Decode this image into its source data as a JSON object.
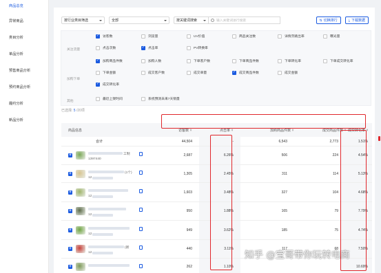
{
  "sidebar": {
    "items": [
      {
        "label": "商品总览",
        "active": true
      },
      {
        "label": "异常商品",
        "active": false
      },
      {
        "label": "类目分析",
        "active": false
      },
      {
        "label": "单品分析",
        "active": false
      },
      {
        "label": "预售商品分析",
        "active": false
      },
      {
        "label": "预约商品分析",
        "active": false
      },
      {
        "label": "履约分析",
        "active": false
      },
      {
        "label": "新品分析",
        "active": false
      }
    ]
  },
  "filters": {
    "category_select": "按行业类目筛选",
    "all_select": "全部",
    "search_mode": "按关键词搜索",
    "search_placeholder": "输入关键词进行搜索",
    "sort_button": "切换排行",
    "download_button": "下载数据"
  },
  "metrics": {
    "groups": [
      {
        "label": "关注流量",
        "rows": [
          [
            {
              "label": "访客数",
              "checked": true
            },
            {
              "label": "浏览量",
              "checked": false
            },
            {
              "label": "UV价值",
              "checked": false
            },
            {
              "label": "商品关注数",
              "checked": false
            },
            {
              "label": "详情页跳出率",
              "checked": false
            },
            {
              "label": "曝光量",
              "checked": false
            }
          ],
          [
            {
              "label": "点击次数",
              "checked": false
            },
            {
              "label": "点击率",
              "checked": true
            },
            {
              "label": "PV转换率",
              "checked": false
            }
          ]
        ]
      },
      {
        "label": "加购下单",
        "rows": [
          [
            {
              "label": "加购商品件数",
              "checked": true
            },
            {
              "label": "加购人数",
              "checked": false
            },
            {
              "label": "下单客户数",
              "checked": false
            },
            {
              "label": "下单商品件数",
              "checked": false
            },
            {
              "label": "下单转化率",
              "checked": false
            },
            {
              "label": "下单成交转化率",
              "checked": false
            }
          ],
          [
            {
              "label": "下单金额",
              "checked": false
            },
            {
              "label": "成交客户数",
              "checked": false
            },
            {
              "label": "成交单量",
              "checked": false
            },
            {
              "label": "成交商品件数",
              "checked": true
            },
            {
              "label": "成交金额",
              "checked": false
            }
          ],
          [
            {
              "label": "成交转化率",
              "checked": true
            }
          ]
        ]
      },
      {
        "label": "其他",
        "rows": [
          [
            {
              "label": "最近上架时间",
              "checked": false
            },
            {
              "label": "系统预测未来7天销量",
              "checked": false
            }
          ]
        ]
      }
    ]
  },
  "selected": {
    "prefix": "已选择:",
    "count": "5",
    "suffix": "/20项"
  },
  "table": {
    "headers": [
      "商品信息",
      "访客数",
      "点击率",
      "加购商品件数",
      "成交商品件数",
      "成交转化率"
    ],
    "total": {
      "label": "合计",
      "values": [
        "44,504",
        "-",
        "6,543",
        "2,773",
        "1.51%"
      ]
    },
    "rows": [
      {
        "name": "工制",
        "id": "1397440",
        "values": [
          "2,687",
          "6.26%",
          "506",
          "224",
          "4.54%"
        ],
        "thumb": "#7aa857"
      },
      {
        "name": "(1个)",
        "id": "12",
        "values": [
          "1,305",
          "2.45%",
          "311",
          "114",
          "5.13%"
        ],
        "thumb": "#d7c48f"
      },
      {
        "name": "",
        "id": "12",
        "values": [
          "1,603",
          "3.48%",
          "327",
          "104",
          "4.68%"
        ],
        "thumb": "#9fb46a"
      },
      {
        "name": "",
        "id": "12",
        "values": [
          "950",
          "1.88%",
          "165",
          "79",
          "7.79%"
        ],
        "thumb": "#5c6b4a"
      },
      {
        "name": "",
        "id": "12",
        "values": [
          "949",
          "3.62%",
          "185",
          "75",
          "4.74%"
        ],
        "thumb": "#6fa442"
      },
      {
        "name": "(新",
        "id": "12",
        "values": [
          "440",
          "3.11%",
          "117",
          "68",
          "7.50%"
        ],
        "thumb": "#c8403a"
      },
      {
        "name": "",
        "id": "",
        "values": [
          "262",
          "1.10%",
          "",
          "",
          "10.69%"
        ],
        "thumb": "#7e9a5a"
      }
    ]
  },
  "watermark": "知乎 @宝哥带你玩转电商",
  "colors": {
    "accent": "#1a5ae0",
    "highlight": "#e0262b"
  }
}
